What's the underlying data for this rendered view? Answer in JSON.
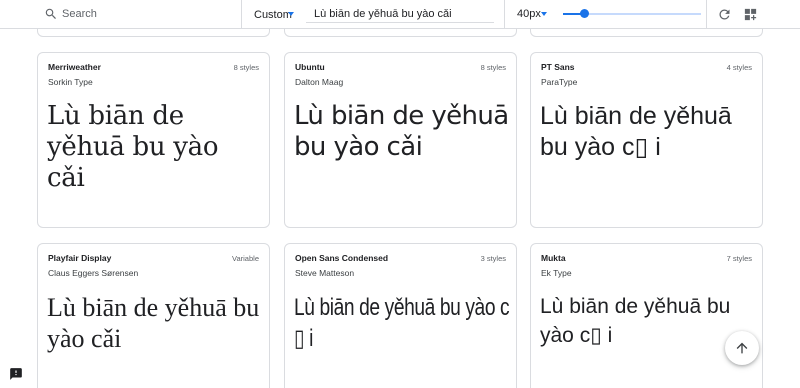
{
  "toolbar": {
    "search_placeholder": "Search",
    "mode_label": "Custom",
    "sample_text": "Lù biān de yěhuā bu yào cǎi",
    "font_size_label": "40px",
    "font_size_fraction": 0.15
  },
  "cards": [
    {
      "name": "Merriweather",
      "author": "Sorkin Type",
      "styles": "8 styles",
      "sample": "Lù biān de yěhuā bu yào cǎi"
    },
    {
      "name": "Ubuntu",
      "author": "Dalton Maag",
      "styles": "8 styles",
      "sample": "Lù biān de yěhuā bu yào cǎi"
    },
    {
      "name": "PT Sans",
      "author": "ParaType",
      "styles": "4 styles",
      "sample": "Lù biān de yěhuā bu yào c▯ i"
    },
    {
      "name": "Playfair Display",
      "author": "Claus Eggers Sørensen",
      "styles": "Variable",
      "sample": "Lù biān de yěhuā bu yào cǎi"
    },
    {
      "name": "Open Sans Condensed",
      "author": "Steve Matteson",
      "styles": "3 styles",
      "sample": "Lù biān de yěhuā bu yào c ▯ i"
    },
    {
      "name": "Mukta",
      "author": "Ek Type",
      "styles": "7 styles",
      "sample": "Lù biān de yěhuā bu yào c▯ i"
    }
  ],
  "icons": {
    "search": "search-icon",
    "refresh": "refresh-icon",
    "grid": "grid-add-icon",
    "back_to_top": "arrow-up-icon",
    "feedback": "feedback-icon"
  },
  "colors": {
    "accent": "#1a73e8",
    "border": "#dadce0",
    "text": "#202124"
  }
}
